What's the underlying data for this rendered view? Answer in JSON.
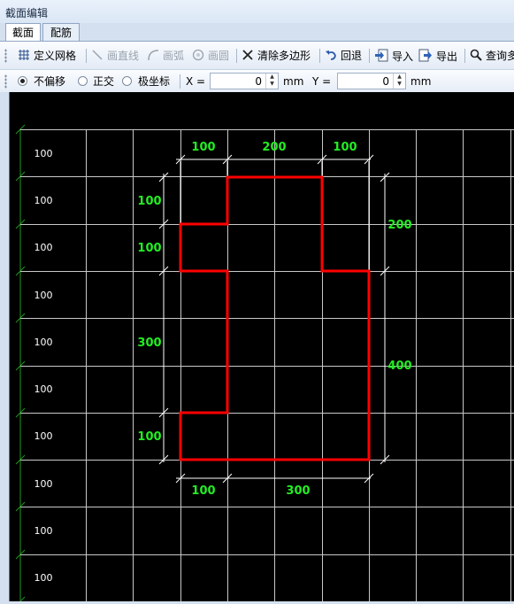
{
  "window": {
    "title": "截面编辑"
  },
  "tabs": [
    {
      "label": "截面",
      "active": true
    },
    {
      "label": "配筋",
      "active": false
    }
  ],
  "toolbar": {
    "define_grid": "定义网格",
    "draw_line": "画直线",
    "draw_arc": "画弧",
    "draw_circle": "画圆",
    "clear_polygon": "清除多边形",
    "undo": "回退",
    "import": "导入",
    "export": "导出",
    "query": "查询多"
  },
  "offset_bar": {
    "options": [
      "不偏移",
      "正交",
      "极坐标"
    ],
    "selected": "不偏移",
    "x_label": "X =",
    "x_value": "0",
    "x_unit": "mm",
    "y_label": "Y =",
    "y_value": "0",
    "y_unit": "mm"
  },
  "grid": {
    "row_labels": [
      "100",
      "100",
      "100",
      "100",
      "100",
      "100",
      "100",
      "100",
      "100",
      "100"
    ],
    "dims_top": [
      "100",
      "200",
      "100"
    ],
    "dims_left": [
      "100",
      "100",
      "300",
      "100"
    ],
    "dims_right": [
      "200",
      "400"
    ],
    "dims_bottom": [
      "100",
      "300"
    ]
  },
  "colors": {
    "canvas_bg": "#000000",
    "grid_line": "#c8c8c8",
    "polygon": "#ff0000",
    "dimension_text": "#22ee22",
    "axis_green": "#1f9a1f"
  }
}
